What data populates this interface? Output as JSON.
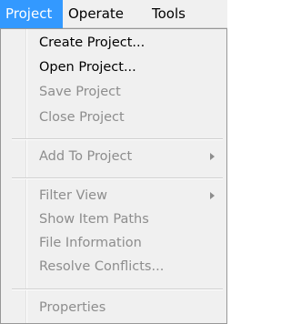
{
  "menubar": {
    "items": [
      {
        "label": "Project",
        "active": true
      },
      {
        "label": "Operate",
        "active": false
      },
      {
        "label": "Tools",
        "active": false
      }
    ]
  },
  "menu": {
    "items": [
      {
        "label": "Create Project...",
        "enabled": true
      },
      {
        "label": "Open Project...",
        "enabled": true
      },
      {
        "label": "Save Project",
        "enabled": false
      },
      {
        "label": "Close Project",
        "enabled": false
      },
      {
        "label": "Add To Project",
        "enabled": false,
        "submenu": true
      },
      {
        "label": "Filter View",
        "enabled": false,
        "submenu": true
      },
      {
        "label": "Show Item Paths",
        "enabled": false
      },
      {
        "label": "File Information",
        "enabled": false
      },
      {
        "label": "Resolve Conflicts...",
        "enabled": false
      },
      {
        "label": "Properties",
        "enabled": false
      }
    ],
    "submenu_icon": "triangle-right-icon"
  },
  "colors": {
    "menubar_bg": "#f0f0f0",
    "active_bg": "#3399ff",
    "enabled_text": "#000000",
    "disabled_text": "#8d8d8d"
  }
}
